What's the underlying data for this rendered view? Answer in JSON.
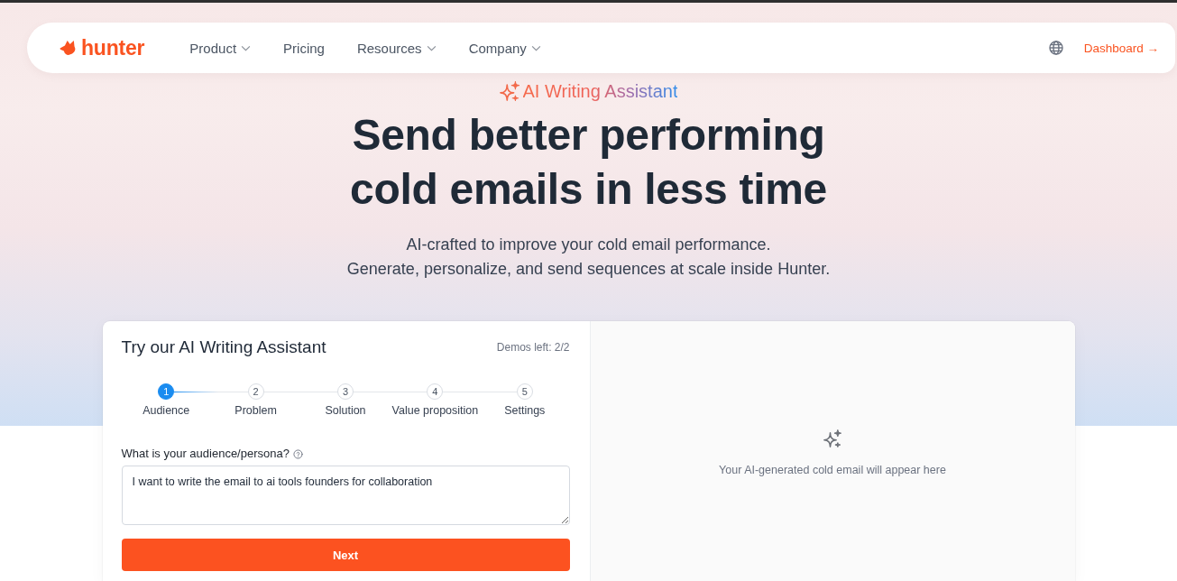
{
  "nav": {
    "logo": "hunter",
    "items": [
      {
        "label": "Product",
        "dropdown": true
      },
      {
        "label": "Pricing",
        "dropdown": false
      },
      {
        "label": "Resources",
        "dropdown": true
      },
      {
        "label": "Company",
        "dropdown": true
      }
    ],
    "dashboard_link": "Dashboard →"
  },
  "hero": {
    "eyebrow": "AI Writing Assistant",
    "headline": "Send better performing cold emails in less time",
    "subtitle": [
      "AI-crafted to improve your cold email performance.",
      "Generate, personalize, and send sequences at scale inside Hunter."
    ]
  },
  "demo": {
    "title": "Try our AI Writing Assistant",
    "demos_left": "Demos left: 2/2",
    "steps": [
      {
        "number": "1",
        "label": "Audience",
        "selected": true
      },
      {
        "number": "2",
        "label": "Problem",
        "selected": false
      },
      {
        "number": "3",
        "label": "Solution",
        "selected": false
      },
      {
        "number": "4",
        "label": "Value proposition",
        "selected": false
      },
      {
        "number": "5",
        "label": "Settings",
        "selected": false
      }
    ],
    "question": "What is your audience/persona?",
    "answer": "I want to write the email to ai tools founders for collaboration",
    "next_button": "Next",
    "preview_message": "Your AI-generated cold email will appear here"
  }
}
